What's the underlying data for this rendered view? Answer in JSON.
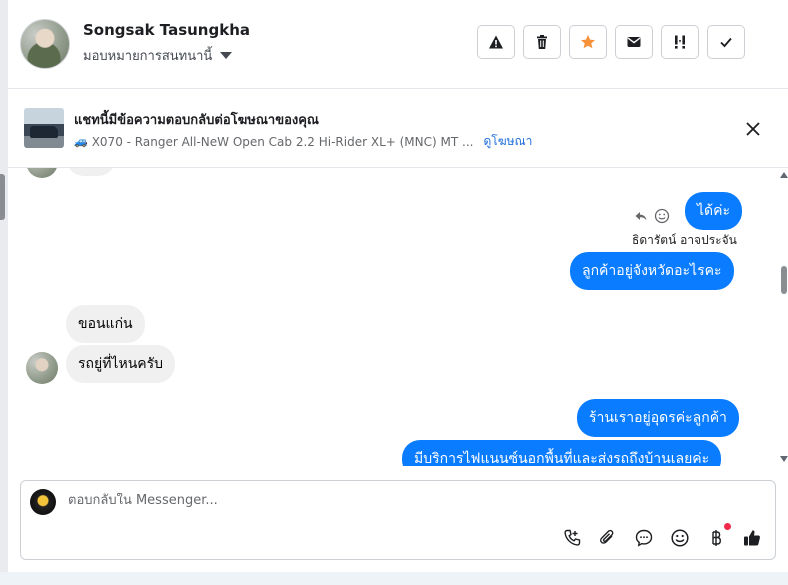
{
  "header": {
    "name": "Songsak Tasungkha",
    "assign_label": "มอบหมายการสนทนานี้",
    "actions": [
      {
        "name": "spam-warning-icon",
        "label": "spam"
      },
      {
        "name": "trash-icon",
        "label": "delete"
      },
      {
        "name": "star-icon",
        "label": "star",
        "color": "#f7923a"
      },
      {
        "name": "envelope-icon",
        "label": "mark unread"
      },
      {
        "name": "follow-up-icon",
        "label": "follow up"
      },
      {
        "name": "checkmark-icon",
        "label": "done"
      }
    ]
  },
  "ad": {
    "title": "แชทนี้มีข้อความตอบกลับต่อโฆษณาของคุณ",
    "product": "X070 - Ranger All-NeW Open Cab 2.2 Hi-Rider XL+ (MNC) MT ...",
    "link": "ดูโฆษณา"
  },
  "messages": [
    {
      "dir": "out",
      "text": "ได้ค่ะ"
    },
    {
      "sender": "ธิดารัตน์ อาจประจัน"
    },
    {
      "dir": "out",
      "text": "ลูกค้าอยู่จังหวัดอะไรคะ"
    },
    {
      "dir": "in",
      "text": "ขอนแก่น"
    },
    {
      "dir": "in",
      "text": "รถยู่ที่ไหนครับ"
    },
    {
      "dir": "out",
      "text": "ร้านเราอยู่อุดรค่ะลูกค้า"
    },
    {
      "dir": "out",
      "text": "มีบริการไฟแนนซ์นอกพื้นที่และส่งรถถึงบ้านเลยค่ะ"
    }
  ],
  "composer": {
    "placeholder": "ตอบกลับใน Messenger...",
    "tools": [
      "phone-icon",
      "paperclip-icon",
      "chat-bubble-icon",
      "emoji-icon",
      "baht-icon",
      "thumbs-up-icon"
    ]
  },
  "colors": {
    "accent": "#0a7cff",
    "star": "#f7923a",
    "link": "#216fdb",
    "notification": "#f02849"
  }
}
